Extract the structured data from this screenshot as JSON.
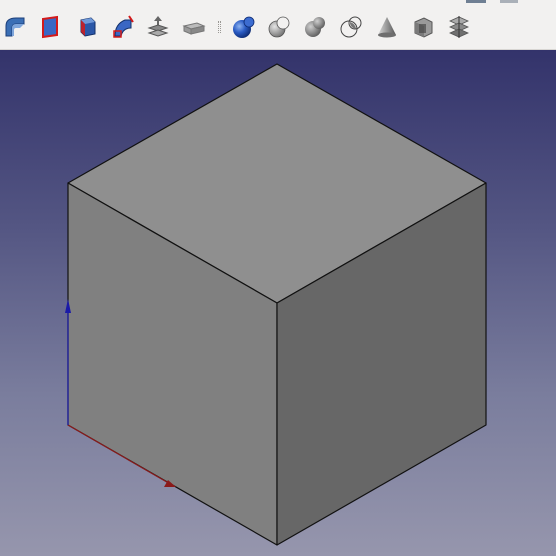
{
  "toolbar": {
    "tools": [
      {
        "name": "sweep-icon"
      },
      {
        "name": "face-icon"
      },
      {
        "name": "extrude-icon"
      },
      {
        "name": "revolve-icon"
      },
      {
        "name": "loft-icon"
      },
      {
        "name": "offset-icon"
      },
      {
        "name": "separator"
      },
      {
        "name": "sphere-icon"
      },
      {
        "name": "boolean-cut-icon"
      },
      {
        "name": "boolean-fuse-icon"
      },
      {
        "name": "boolean-common-icon"
      },
      {
        "name": "cone-icon"
      },
      {
        "name": "section-icon"
      },
      {
        "name": "slice-icon"
      }
    ]
  },
  "viewport": {
    "object": "cube",
    "colors": {
      "top_face": "#8f8f8f",
      "left_face": "#808080",
      "right_face": "#676767",
      "edge": "#111111",
      "x_axis": "#8b1a1a",
      "z_axis": "#1a1aa8"
    }
  }
}
